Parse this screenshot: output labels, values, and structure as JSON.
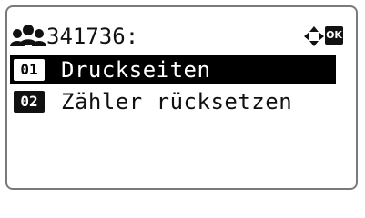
{
  "header": {
    "title": "341736:",
    "user_icon": "users-icon",
    "nav_icon": "four-way-arrow-icon",
    "ok_label": "OK"
  },
  "menu": {
    "items": [
      {
        "number": "01",
        "label": "Druckseiten",
        "selected": true
      },
      {
        "number": "02",
        "label": "Zähler rücksetzen",
        "selected": false
      }
    ]
  },
  "colors": {
    "selected_background": "#000000",
    "text": "#111111",
    "frame": "#7a7a7a"
  }
}
